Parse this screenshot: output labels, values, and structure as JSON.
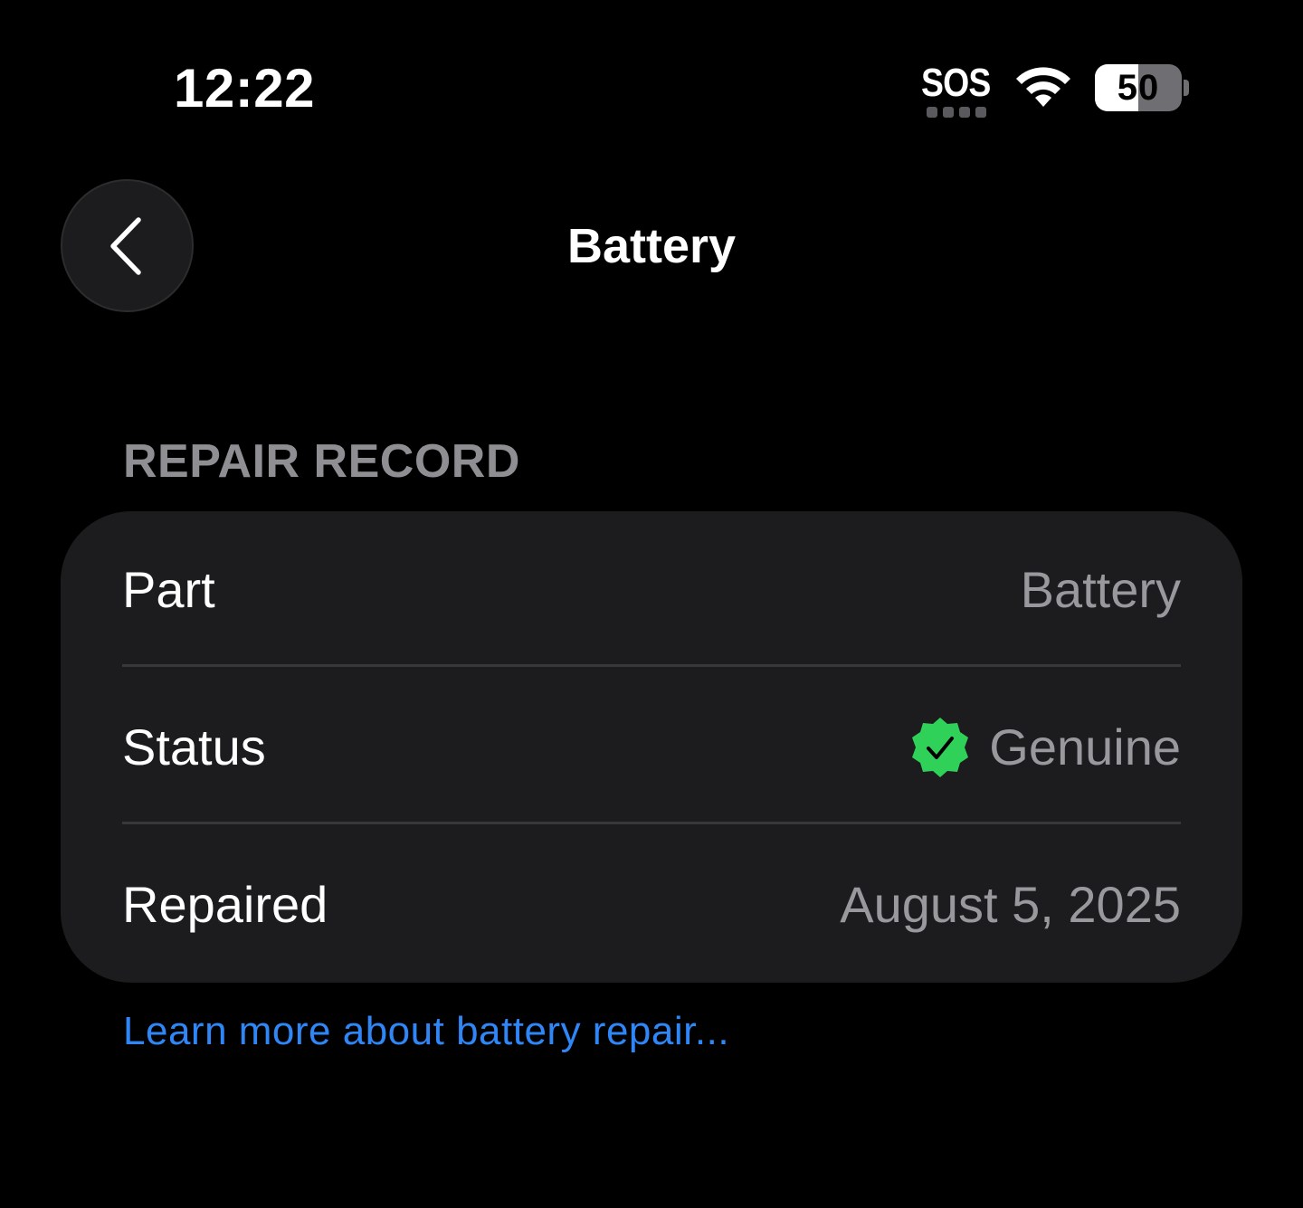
{
  "status_bar": {
    "time": "12:22",
    "carrier": "SOS",
    "battery_level": "50",
    "battery_fraction": 0.5,
    "icons": [
      "wifi-icon",
      "battery-icon",
      "signal-dots-icon"
    ]
  },
  "nav": {
    "back_icon": "chevron-left-icon",
    "title": "Battery"
  },
  "section": {
    "header": "REPAIR RECORD",
    "rows": [
      {
        "label": "Part",
        "value": "Battery"
      },
      {
        "label": "Status",
        "value": "Genuine",
        "icon": "verified-badge-icon"
      },
      {
        "label": "Repaired",
        "value": "August 5, 2025"
      }
    ]
  },
  "footer_link": "Learn more about battery repair...",
  "colors": {
    "background": "#000000",
    "card": "#1c1c1e",
    "secondary_text": "#98989d",
    "link": "#2f86f6",
    "badge_green": "#30d158"
  }
}
